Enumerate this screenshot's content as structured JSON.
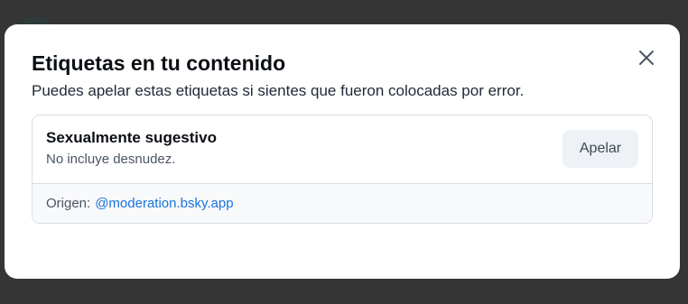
{
  "modal": {
    "title": "Etiquetas en tu contenido",
    "subtitle": "Puedes apelar estas etiquetas si sientes que fueron colocadas por error.",
    "close_icon": "close-icon"
  },
  "labels": [
    {
      "name": "Sexualmente sugestivo",
      "description": "No incluye desnudez.",
      "appeal_label": "Apelar",
      "source_prefix": "Origen:",
      "source_handle": "@moderation.bsky.app"
    }
  ],
  "colors": {
    "accent_link": "#1a73d9",
    "backdrop": "#353535",
    "modal_bg": "#ffffff"
  }
}
